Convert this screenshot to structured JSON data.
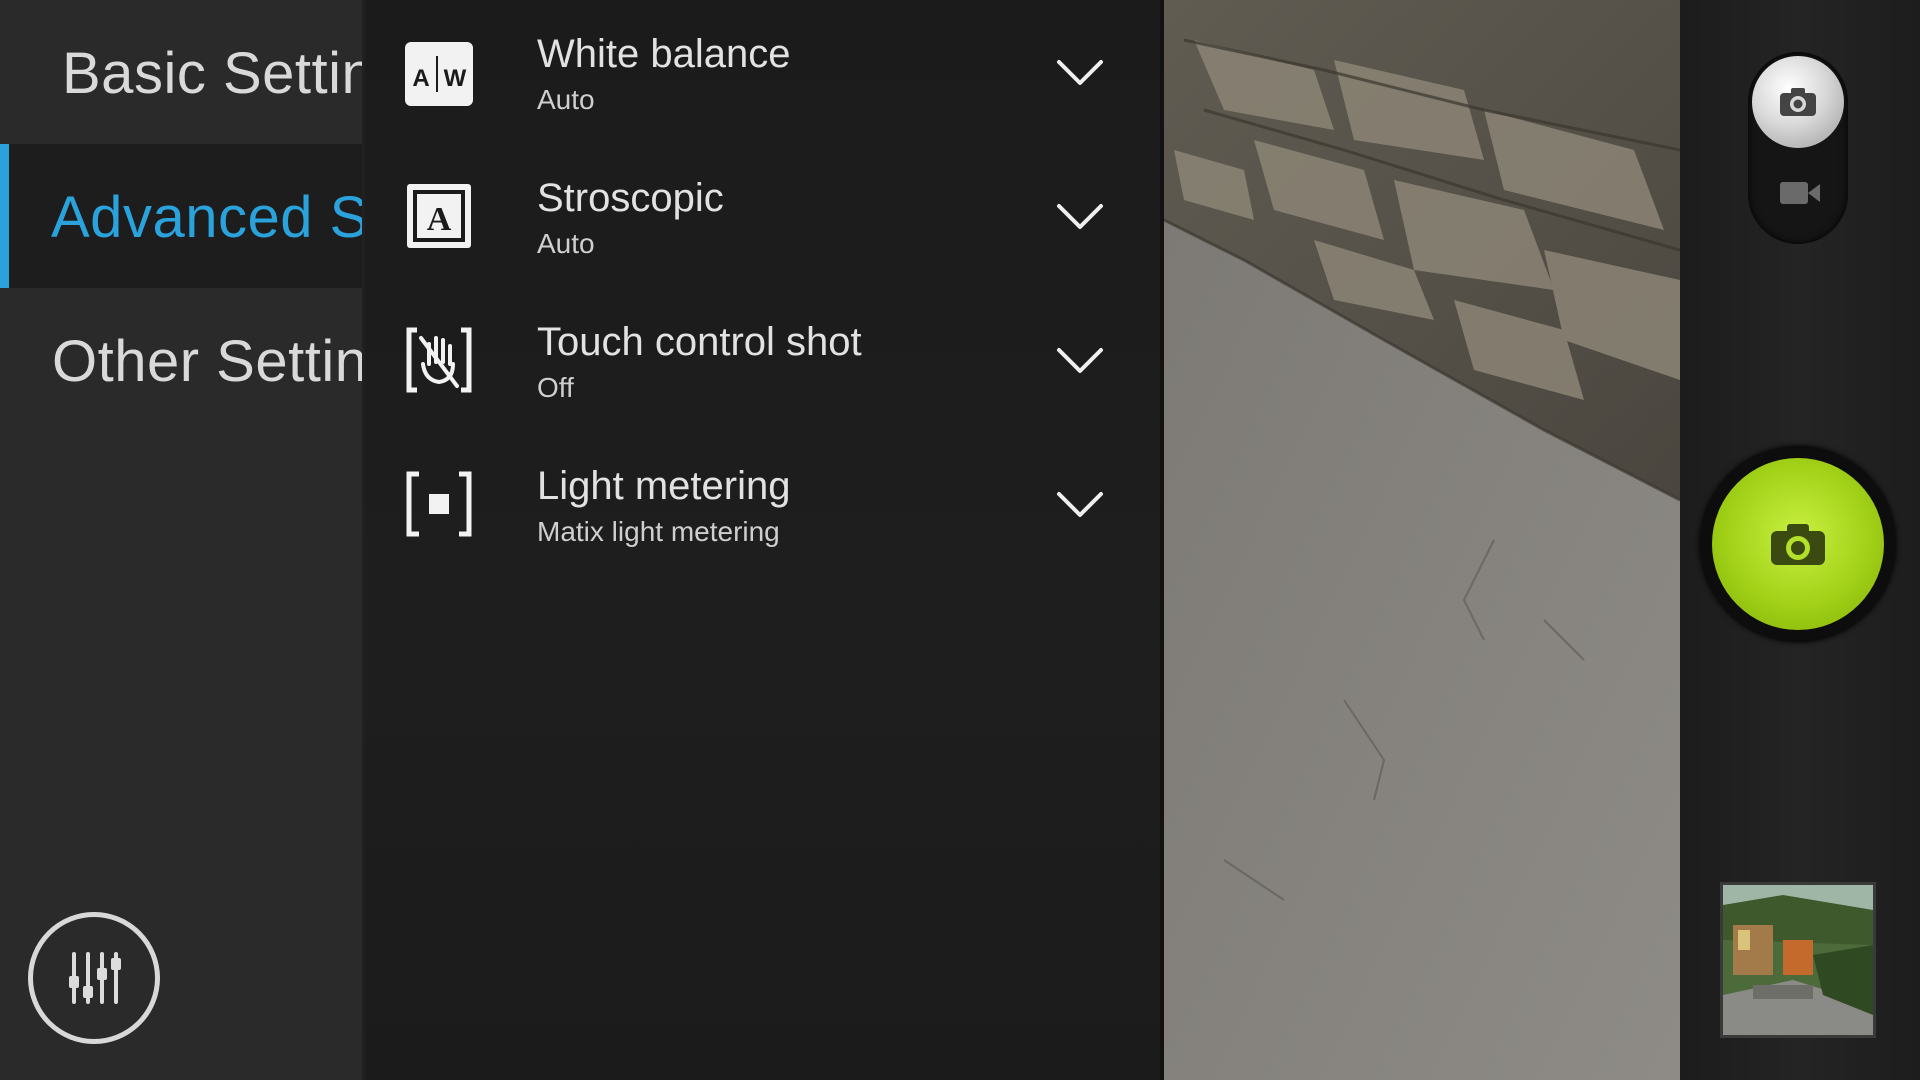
{
  "sidebar": {
    "categories": [
      {
        "label": "Basic Settings",
        "active": false
      },
      {
        "label": "Advanced Settings",
        "active": true
      },
      {
        "label": "Other Settings",
        "active": false
      }
    ],
    "settings_icon": "equalizer-sliders-icon"
  },
  "settings": [
    {
      "title": "White balance",
      "value": "Auto",
      "icon": "white-balance-auto-icon"
    },
    {
      "title": "Stroscopic",
      "value": "Auto",
      "icon": "stroscopic-auto-icon"
    },
    {
      "title": "Touch control shot",
      "value": "Off",
      "icon": "touch-hand-icon"
    },
    {
      "title": "Light metering",
      "value": "Matix light metering",
      "icon": "metering-icon"
    }
  ],
  "controls": {
    "mode_photo_icon": "camera-icon",
    "mode_video_icon": "video-camera-icon",
    "shutter_icon": "camera-icon",
    "gallery_thumbnail": "last-photo-thumbnail"
  },
  "colors": {
    "accent": "#2aa2dc",
    "shutter": "#a2d118"
  }
}
